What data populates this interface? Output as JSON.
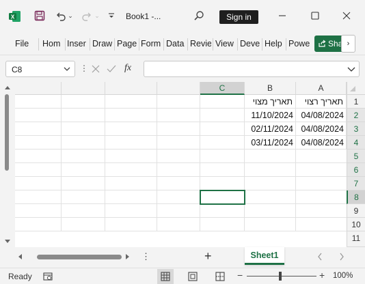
{
  "titlebar": {
    "filename": "Book1  -...",
    "signin_label": "Sign in"
  },
  "ribbon": {
    "tabs": [
      "File",
      "Hom",
      "Inser",
      "Draw",
      "Page",
      "Form",
      "Data",
      "Revie",
      "View",
      "Deve",
      "Help",
      "Powe"
    ],
    "share_label": "Sha"
  },
  "formula_bar": {
    "namebox": "C8",
    "fx": "fx",
    "formula": ""
  },
  "grid": {
    "columns": [
      "C",
      "B",
      "A"
    ],
    "rows": [
      "1",
      "2",
      "3",
      "4",
      "5",
      "6",
      "7",
      "8",
      "9",
      "10",
      "11"
    ],
    "header_row": {
      "B": "תאריך מצוי",
      "A": "תאריך רצוי"
    },
    "data": [
      {
        "B": "11/10/2024",
        "A": "04/08/2024"
      },
      {
        "B": "02/11/2024",
        "A": "04/08/2024"
      },
      {
        "B": "03/11/2024",
        "A": "04/08/2024"
      }
    ]
  },
  "sheets": {
    "tabs": [
      "Sheet1"
    ]
  },
  "statusbar": {
    "ready": "Ready",
    "zoom": "100%"
  },
  "colors": {
    "accent": "#1e7145"
  }
}
